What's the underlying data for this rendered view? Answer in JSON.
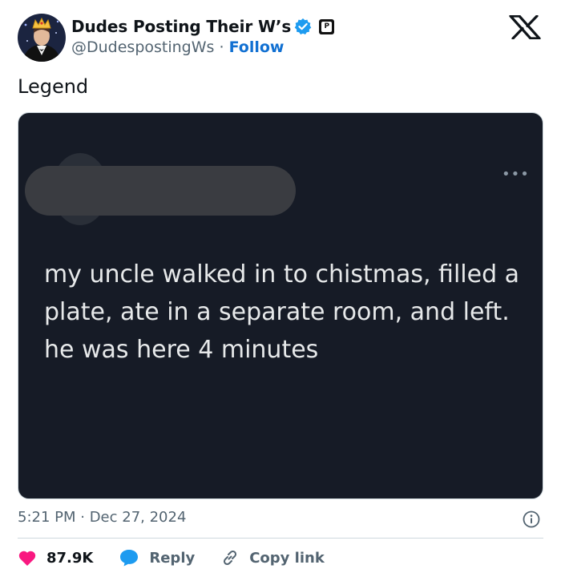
{
  "author": {
    "display_name": "Dudes Posting Their W’s",
    "handle": "@DudespostingWs",
    "separator": "·",
    "follow_label": "Follow"
  },
  "tweet": {
    "text": "Legend",
    "timestamp": "5:21 PM · Dec 27, 2024"
  },
  "media": {
    "screenshot_text": "my uncle walked in to chistmas, filled a plate, ate in a separate room, and left. he was here 4 minutes",
    "menu_glyph": "•••"
  },
  "actions": {
    "likes": "87.9K",
    "reply_label": "Reply",
    "copy_label": "Copy link"
  },
  "icons": [
    "verified-icon",
    "affiliate-badge-icon",
    "x-logo-icon",
    "info-icon",
    "heart-icon",
    "reply-icon",
    "link-icon"
  ],
  "colors": {
    "verified_blue": "#1d9bf0",
    "follow_blue": "#1170d2",
    "heart_pink": "#f91880",
    "media_bg": "#161b26"
  }
}
